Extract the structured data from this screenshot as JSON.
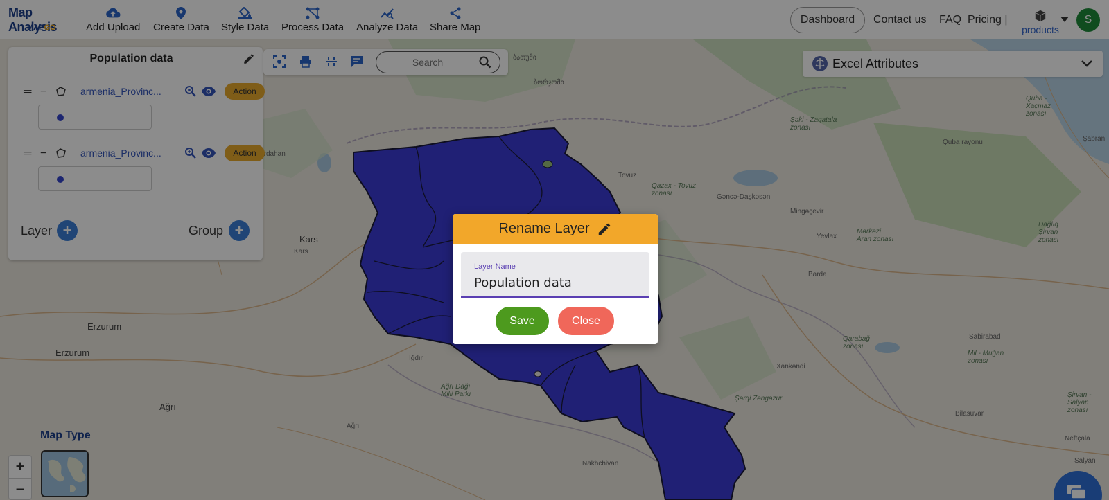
{
  "app": {
    "title": "Map Analysis",
    "subtitle_main": "MAP",
    "subtitle_accent": "GO"
  },
  "nav": {
    "items": [
      {
        "label": "Add Upload",
        "icon": "cloud-upload-icon"
      },
      {
        "label": "Create Data",
        "icon": "location-pin-icon"
      },
      {
        "label": "Style Data",
        "icon": "paint-bucket-icon"
      },
      {
        "label": "Process Data",
        "icon": "process-nodes-icon"
      },
      {
        "label": "Analyze Data",
        "icon": "analyze-chart-icon"
      },
      {
        "label": "Share Map",
        "icon": "share-icon"
      }
    ],
    "dashboard": "Dashboard",
    "contact": "Contact us",
    "faq": "FAQ",
    "pricing": "Pricing |",
    "products": "products",
    "avatar_initial": "S"
  },
  "panel": {
    "title": "Population data",
    "layers": [
      {
        "name": "armenia_Provinc...",
        "action": "Action"
      },
      {
        "name": "armenia_Provinc...",
        "action": "Action"
      }
    ],
    "layer_label": "Layer",
    "group_label": "Group"
  },
  "toolbar": {
    "search_placeholder": "Search"
  },
  "excel": {
    "label": "Excel Attributes"
  },
  "map_type": {
    "label": "Map Type"
  },
  "zoom": {
    "in": "+",
    "out": "−"
  },
  "map_labels": [
    "Erzurum",
    "Erzurum",
    "Ağrı",
    "Ağrı",
    "Ardahan",
    "Kars",
    "Kars",
    "Iğdır",
    "Ağrı Dağı Milli Parkı",
    "Nakhchivan",
    "Tovuz",
    "Qazax - Tovuz zonası",
    "Gəncə-Daşkəsən",
    "Mingəçevir",
    "Yevlax",
    "Barda",
    "Mərkəzi Aran zonası",
    "Şəki - Zaqatala zonası",
    "Quba rayonu",
    "Quba - Xaçmaz zonası",
    "Şabran",
    "Dağlıq Şirvan zonası",
    "Xankəndi",
    "Qarabağ zonası",
    "Sabirabad",
    "Mil - Muğan zonası",
    "Bilasuvar",
    "Neftçala",
    "Salyan",
    "Şirvan - Salyan zonası",
    "Şərqi Zəngəzur",
    "ბათუმი",
    "ბორჯომი"
  ],
  "dialog": {
    "title": "Rename Layer",
    "field_label": "Layer Name",
    "field_value": "Population data",
    "save": "Save",
    "close": "Close"
  },
  "colors": {
    "brand": "#1c3f8a",
    "dialog_header": "#f2a72a",
    "save": "#4d9a1e",
    "close": "#f0675a",
    "action": "#e8a92c",
    "region_fill": "#3b3bd6",
    "accent": "#3b7ed8"
  }
}
